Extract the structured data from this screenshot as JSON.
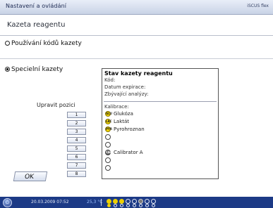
{
  "window": {
    "title": "Nastavení a ovládání",
    "brand": "iSCUS flex"
  },
  "page": {
    "section_title": "Kazeta reagentu"
  },
  "options": {
    "codes_label": "Používání kódů kazety",
    "special_label": "Specielní kazety"
  },
  "positions": {
    "label": "Upravit pozici",
    "buttons": [
      "1",
      "2",
      "3",
      "4",
      "5",
      "6",
      "7",
      "8"
    ]
  },
  "ok_label": "OK",
  "status_panel": {
    "title": "Stav kazety reagentu",
    "code_label": "Kód:",
    "expiry_label": "Datum expirace:",
    "remaining_label": "Zbývající analýzy:",
    "calibration_label": "Kalibrace:",
    "calibrations": [
      {
        "icon_text": "GLU",
        "name": "Glukóza",
        "color": "yellow"
      },
      {
        "icon_text": "LAC",
        "name": "Laktát",
        "color": "yellow"
      },
      {
        "icon_text": "PYR",
        "name": "Pyrohroznan",
        "color": "yellow"
      },
      {
        "icon_text": "",
        "name": "",
        "color": "empty"
      },
      {
        "icon_text": "",
        "name": "",
        "color": "empty"
      },
      {
        "icon_text": "CAL",
        "name": "Calibrator A",
        "color": "gray"
      },
      {
        "icon_text": "",
        "name": "",
        "color": "empty"
      },
      {
        "icon_text": "",
        "name": "",
        "color": "empty"
      }
    ]
  },
  "statusbar": {
    "datetime": "20.03.2009 07:52",
    "temperature": "25,3 °C"
  },
  "colors": {
    "accent": "#1c3a86",
    "highlight": "#f0d000"
  }
}
